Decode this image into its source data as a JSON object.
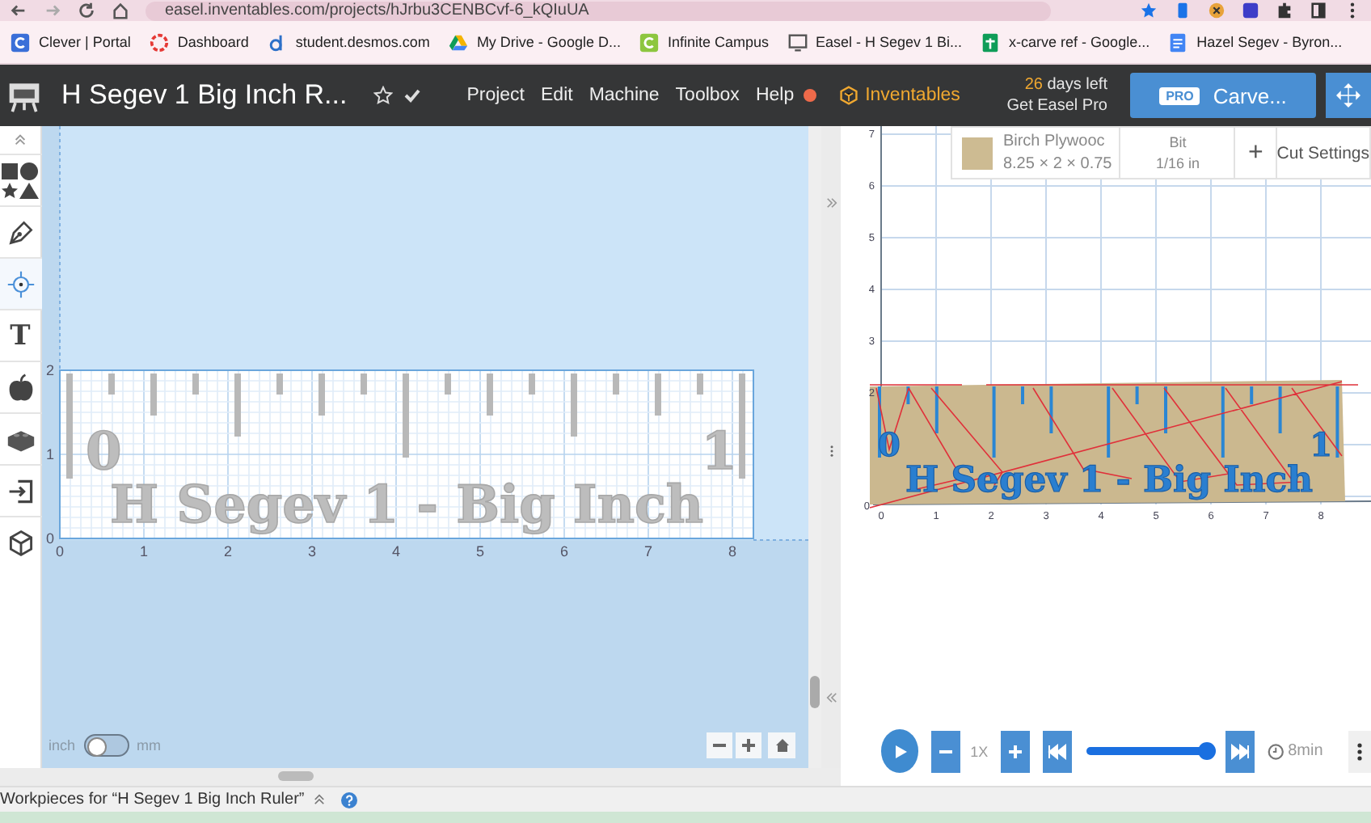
{
  "browser": {
    "url": "easel.inventables.com/projects/hJrbu3CENBCvf-6_kQIuUA"
  },
  "bookmarks": [
    {
      "kind": "c",
      "label": "Clever | Portal"
    },
    {
      "kind": "ring",
      "label": "Dashboard"
    },
    {
      "kind": "d",
      "label": "student.desmos.com"
    },
    {
      "kind": "triangle",
      "label": "My Drive - Google D..."
    },
    {
      "kind": "c-green",
      "label": "Infinite Campus"
    },
    {
      "kind": "monitor",
      "label": "Easel - H Segev 1 Bi..."
    },
    {
      "kind": "sheet",
      "label": "x-carve ref - Google..."
    },
    {
      "kind": "doc",
      "label": "Hazel Segev - Byron..."
    }
  ],
  "header": {
    "title": "H Segev 1 Big Inch R...",
    "starred": false,
    "menu": [
      "Project",
      "Edit",
      "Machine",
      "Toolbox",
      "Help"
    ],
    "notification": true,
    "brand": "Inventables",
    "trial_days": "26",
    "trial_text": "days left",
    "upgrade": "Get Easel Pro",
    "carve_badge": "PRO",
    "carve_label": "Carve..."
  },
  "toolbar": [
    {
      "kind": "shapes"
    },
    {
      "kind": "pen"
    },
    {
      "kind": "target",
      "selected": true
    },
    {
      "kind": "text",
      "label": "T"
    },
    {
      "kind": "apple"
    },
    {
      "kind": "brick"
    },
    {
      "kind": "import"
    },
    {
      "kind": "cube"
    }
  ],
  "design_canvas": {
    "x_ticks": [
      "0",
      "1",
      "2",
      "3",
      "4",
      "5",
      "6",
      "7",
      "8"
    ],
    "y_ticks": [
      "2",
      "1",
      "0"
    ],
    "left_number": "0",
    "right_number": "1",
    "caption": "H Segev 1 - Big Inch"
  },
  "units": {
    "left_label": "inch",
    "right_label": "mm",
    "on": false
  },
  "preview": {
    "material": "Birch Plywooc",
    "dimensions": "8.25 × 2 × 0.75",
    "bit_label": "Bit",
    "bit": "1/16 in",
    "add": "+",
    "cut_settings": "Cut Settings",
    "x_ticks": [
      "0",
      "1",
      "2",
      "3",
      "4",
      "5",
      "6",
      "7",
      "8"
    ],
    "y_ticks": [
      "7",
      "6",
      "5",
      "4",
      "3",
      "2",
      "0"
    ],
    "left_number": "0",
    "right_number": "1",
    "caption": "H Segev 1 - Big Inch"
  },
  "playback": {
    "speed": "1X",
    "level": 1.0,
    "duration": "8min"
  },
  "footer": {
    "text": "Workpieces for “H Segev 1 Big Inch Ruler”"
  }
}
